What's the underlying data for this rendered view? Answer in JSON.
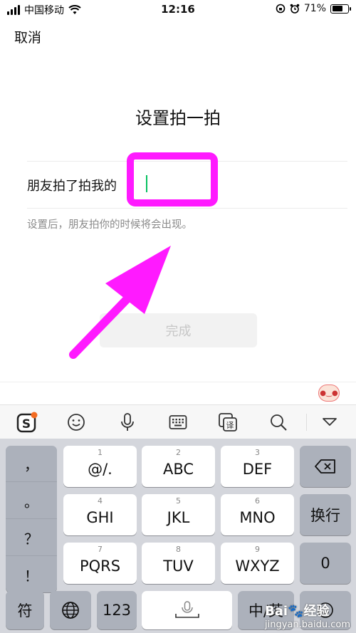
{
  "status_bar": {
    "carrier": "中国移动",
    "time": "12:16",
    "battery": "71%",
    "battery_level": 0.71
  },
  "nav": {
    "cancel": "取消"
  },
  "page": {
    "title": "设置拍一拍",
    "label": "朋友拍了拍我的",
    "input_value": "",
    "hint": "设置后，朋友拍你的时候将会出现。",
    "done": "完成"
  },
  "toolbar": {
    "icons": [
      "sogou-logo-icon",
      "emoji-icon",
      "microphone-icon",
      "keyboard-icon",
      "translate-icon",
      "search-icon",
      "collapse-icon"
    ],
    "translate_glyph": "译"
  },
  "keyboard": {
    "punct": [
      "，",
      "。",
      "？",
      "！"
    ],
    "keys": [
      {
        "num": "1",
        "label": "@/."
      },
      {
        "num": "2",
        "label": "ABC"
      },
      {
        "num": "3",
        "label": "DEF"
      },
      {
        "num": "4",
        "label": "GHI"
      },
      {
        "num": "5",
        "label": "JKL"
      },
      {
        "num": "6",
        "label": "MNO"
      },
      {
        "num": "7",
        "label": "PQRS"
      },
      {
        "num": "8",
        "label": "TUV"
      },
      {
        "num": "9",
        "label": "WXYZ"
      }
    ],
    "newline": "换行",
    "zero": "0",
    "symbol": "符",
    "num_switch": "123",
    "lang": "中/英"
  },
  "watermark": {
    "brand": "Bai",
    "brand2": "经验",
    "url": "jingyan.baidu.com"
  },
  "colors": {
    "accent": "#07c160",
    "annotation": "#ff1aff"
  }
}
